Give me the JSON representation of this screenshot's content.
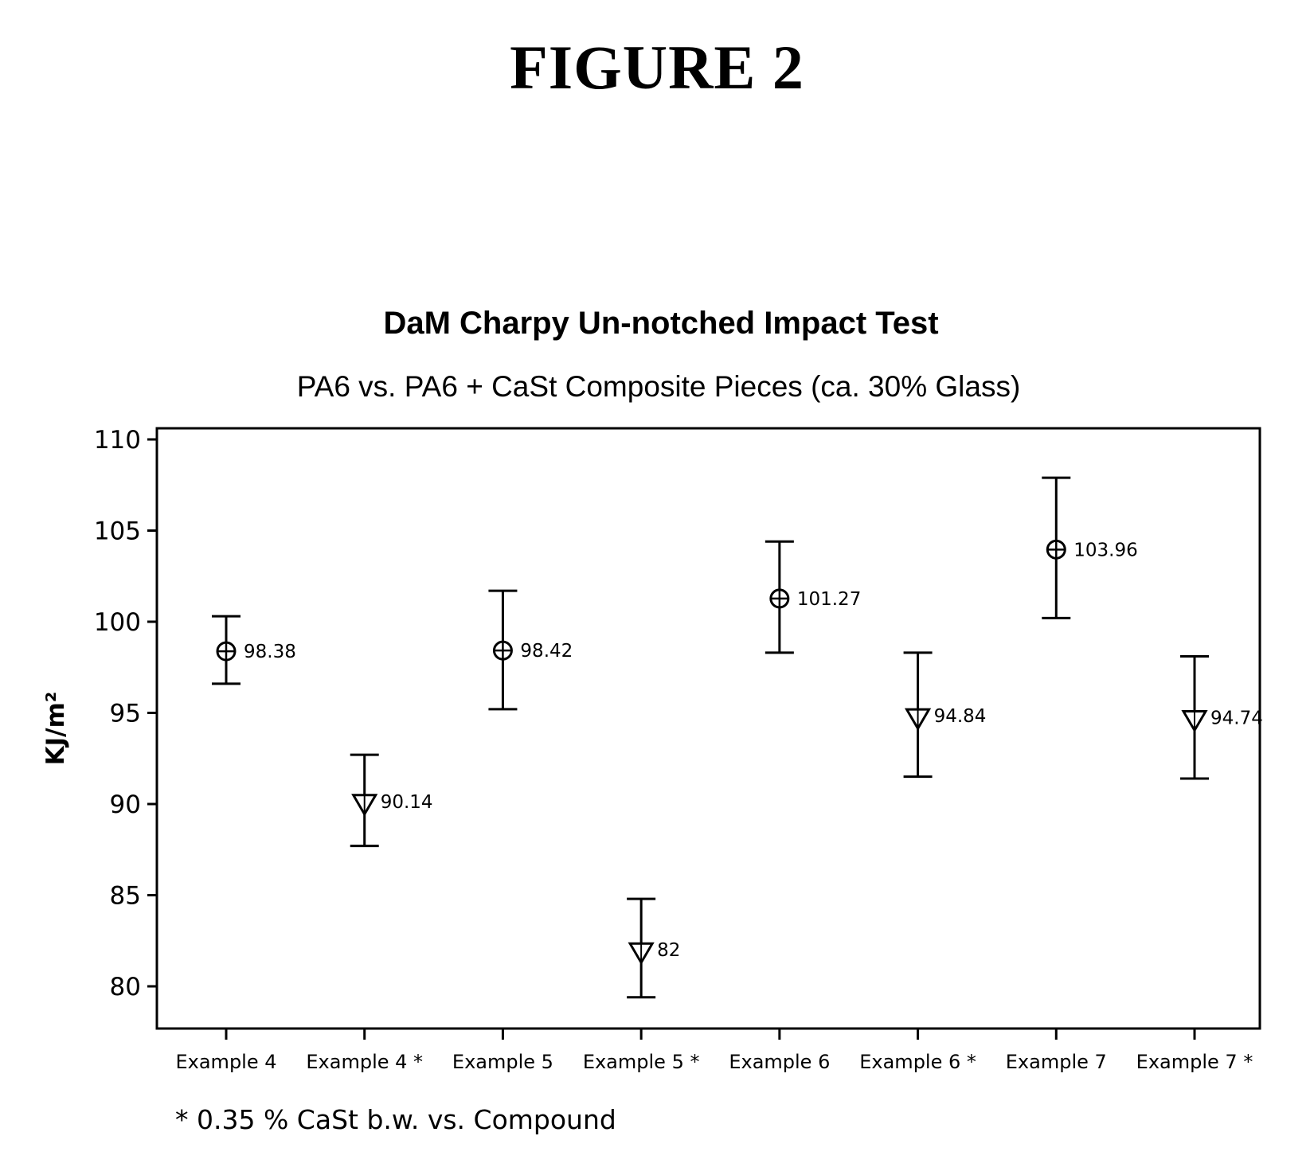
{
  "figure_heading": "FIGURE 2",
  "footnote": "* 0.35 % CaSt  b.w. vs. Compound",
  "chart_data": {
    "type": "scatter",
    "subtype": "interval plot (mean with error bars)",
    "title": "DaM  Charpy Un-notched Impact Test",
    "subtitle": "PA6  vs.  PA6 + CaSt   Composite Pieces (ca. 30% Glass)",
    "xlabel": "",
    "ylabel": "KJ/m²",
    "ylim": [
      77.7,
      110.7
    ],
    "yticks": [
      80,
      85,
      90,
      95,
      100,
      105,
      110
    ],
    "grid": false,
    "legend": "none",
    "categories": [
      "Example 4",
      "Example 4 *",
      "Example 5",
      "Example 5 *",
      "Example 6",
      "Example 6 *",
      "Example 7",
      "Example 7 *"
    ],
    "points": [
      {
        "category": "Example 4",
        "mean": 98.38,
        "label": "98.38",
        "lower": 96.6,
        "upper": 100.3,
        "marker": "circle-cross"
      },
      {
        "category": "Example 4 *",
        "mean": 90.14,
        "label": "90.14",
        "lower": 87.7,
        "upper": 92.7,
        "marker": "triangle-down"
      },
      {
        "category": "Example 5",
        "mean": 98.42,
        "label": "98.42",
        "lower": 95.2,
        "upper": 101.7,
        "marker": "circle-cross"
      },
      {
        "category": "Example 5 *",
        "mean": 82,
        "label": "82",
        "lower": 79.4,
        "upper": 84.8,
        "marker": "triangle-down"
      },
      {
        "category": "Example 6",
        "mean": 101.27,
        "label": "101.27",
        "lower": 98.3,
        "upper": 104.4,
        "marker": "circle-cross"
      },
      {
        "category": "Example 6 *",
        "mean": 94.84,
        "label": "94.84",
        "lower": 91.5,
        "upper": 98.3,
        "marker": "triangle-down"
      },
      {
        "category": "Example 7",
        "mean": 103.96,
        "label": "103.96",
        "lower": 100.2,
        "upper": 107.9,
        "marker": "circle-cross"
      },
      {
        "category": "Example 7 *",
        "mean": 94.74,
        "label": "94.74",
        "lower": 91.4,
        "upper": 98.1,
        "marker": "triangle-down"
      }
    ],
    "colors": {
      "ink": "#000000",
      "background": "#ffffff"
    }
  }
}
